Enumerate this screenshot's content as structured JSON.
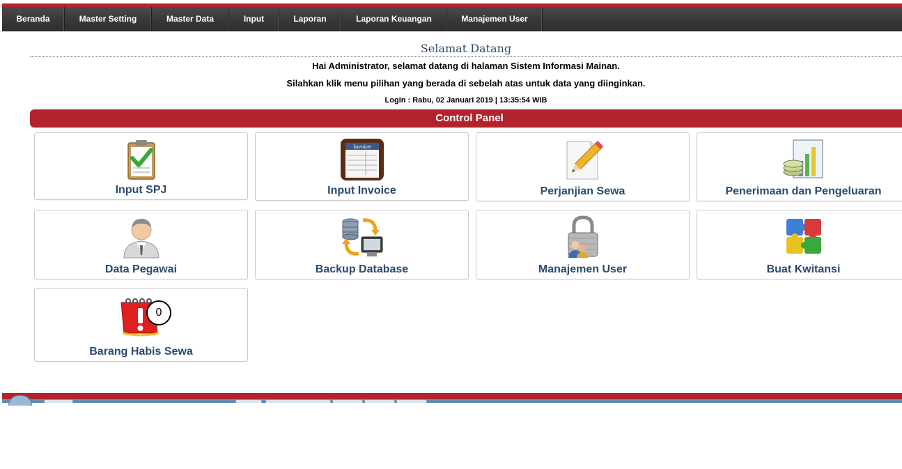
{
  "nav": {
    "items": [
      {
        "label": "Beranda"
      },
      {
        "label": "Master Setting"
      },
      {
        "label": "Master Data"
      },
      {
        "label": "Input"
      },
      {
        "label": "Laporan"
      },
      {
        "label": "Laporan Keuangan"
      },
      {
        "label": "Manajemen User"
      }
    ]
  },
  "welcome": {
    "title": "Selamat Datang",
    "greeting": "Hai Administrator, selamat datang di halaman Sistem Informasi Mainan.",
    "instruction": "Silahkan klik menu pilihan yang berada di sebelah atas untuk data yang diinginkan.",
    "login": "Login : Rabu, 02 Januari 2019 | 13:35:54 WIB"
  },
  "control_panel": {
    "title": "Control Panel",
    "cards": [
      {
        "label": "Input SPJ",
        "icon": "clipboard-check-icon"
      },
      {
        "label": "Input Invoice",
        "icon": "invoice-icon",
        "icon_text": "Invoice"
      },
      {
        "label": "Perjanjian Sewa",
        "icon": "pencil-document-icon"
      },
      {
        "label": "Penerimaan dan Pengeluaran",
        "icon": "money-chart-icon"
      },
      {
        "label": "Data Pegawai",
        "icon": "employee-icon"
      },
      {
        "label": "Backup Database",
        "icon": "database-backup-icon"
      },
      {
        "label": "Manajemen User",
        "icon": "padlock-user-icon"
      },
      {
        "label": "Buat Kwitansi",
        "icon": "puzzle-icon"
      },
      {
        "label": "Barang Habis Sewa",
        "icon": "calendar-alert-icon",
        "badge": "0"
      }
    ]
  },
  "colors": {
    "brand_red": "#b3232c",
    "nav_dark": "#383838",
    "label_blue": "#2b4b6f"
  }
}
